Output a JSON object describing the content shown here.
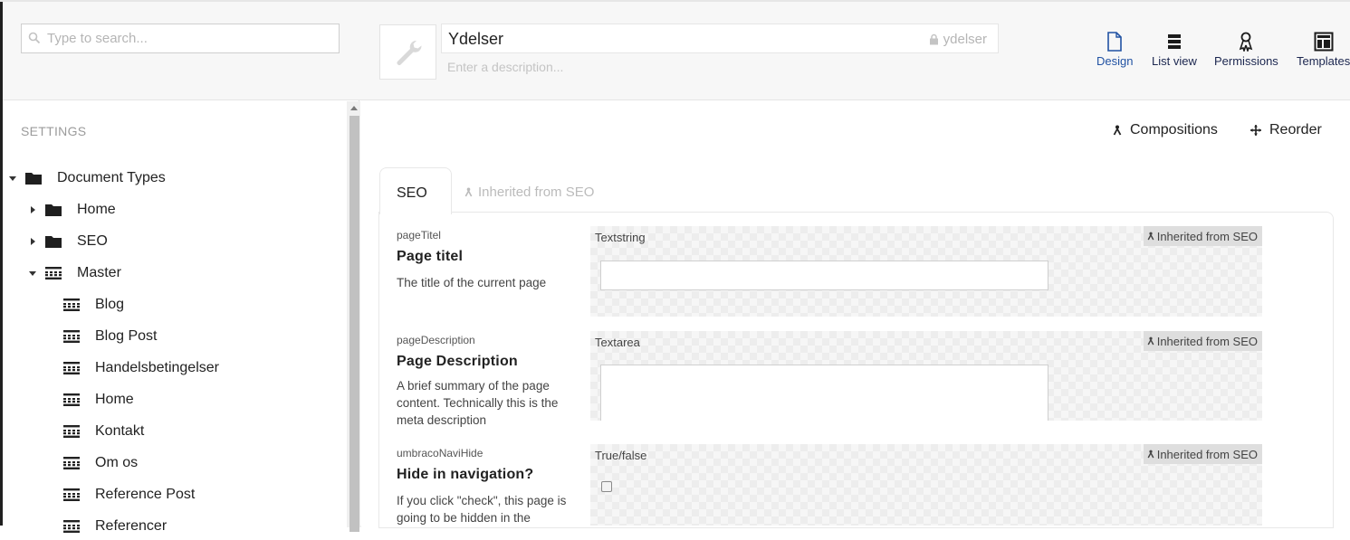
{
  "search": {
    "placeholder": "Type to search..."
  },
  "sidebar": {
    "section_title": "SETTINGS",
    "tree": [
      {
        "label": "Document Types",
        "icon": "folder-icon",
        "expanded": true
      },
      {
        "label": "Home",
        "icon": "folder-icon",
        "expanded": false
      },
      {
        "label": "SEO",
        "icon": "folder-icon",
        "expanded": false
      },
      {
        "label": "Master",
        "icon": "doctype-icon",
        "expanded": true
      },
      {
        "label": "Blog",
        "icon": "doctype-icon"
      },
      {
        "label": "Blog Post",
        "icon": "doctype-icon"
      },
      {
        "label": "Handelsbetingelser",
        "icon": "doctype-icon"
      },
      {
        "label": "Home",
        "icon": "doctype-icon"
      },
      {
        "label": "Kontakt",
        "icon": "doctype-icon"
      },
      {
        "label": "Om os",
        "icon": "doctype-icon"
      },
      {
        "label": "Reference Post",
        "icon": "doctype-icon"
      },
      {
        "label": "Referencer",
        "icon": "doctype-icon"
      }
    ]
  },
  "header": {
    "name": "Ydelser",
    "alias": "ydelser",
    "description_placeholder": "Enter a description...",
    "apps": [
      {
        "label": "Design",
        "icon": "design-icon",
        "active": true
      },
      {
        "label": "List view",
        "icon": "list-view-icon"
      },
      {
        "label": "Permissions",
        "icon": "permissions-icon"
      },
      {
        "label": "Templates",
        "icon": "templates-icon"
      }
    ]
  },
  "toolbar": {
    "compositions": "Compositions",
    "reorder": "Reorder"
  },
  "tabs": {
    "active": "SEO",
    "inherited": "Inherited from SEO"
  },
  "properties": [
    {
      "alias": "pageTitel",
      "label": "Page titel",
      "description": "The title of the current page",
      "editor": "Textstring",
      "badge": "Inherited from SEO"
    },
    {
      "alias": "pageDescription",
      "label": "Page Description",
      "description": "A brief summary of the page content. Technically this is the meta description",
      "editor": "Textarea",
      "badge": "Inherited from SEO"
    },
    {
      "alias": "umbracoNaviHide",
      "label": "Hide in navigation?",
      "description": "If you click \"check\", this page is going to be hidden in the",
      "editor": "True/false",
      "badge": "Inherited from SEO"
    }
  ],
  "colors": {
    "accent": "#2152a3",
    "text": "#1b264f"
  }
}
